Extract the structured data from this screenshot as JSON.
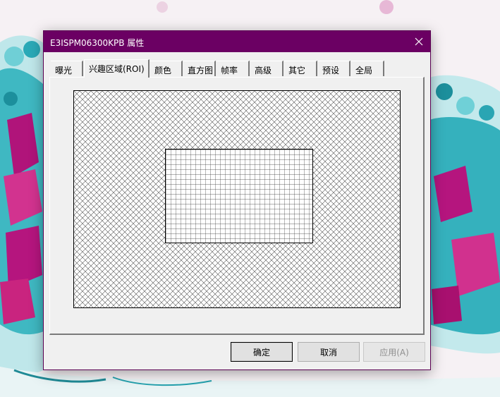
{
  "window": {
    "title": "E3ISPM06300KPB 属性",
    "close_icon": "close-icon"
  },
  "tabs": [
    {
      "label": "曝光",
      "active": false
    },
    {
      "label": "兴趣区域(ROI)",
      "active": true
    },
    {
      "label": "颜色",
      "active": false
    },
    {
      "label": "直方图",
      "active": false
    },
    {
      "label": "帧率",
      "active": false
    },
    {
      "label": "高级",
      "active": false
    },
    {
      "label": "其它",
      "active": false
    },
    {
      "label": "预设",
      "active": false
    },
    {
      "label": "全局",
      "active": false
    }
  ],
  "buttons": {
    "ok": "确定",
    "cancel": "取消",
    "apply": "应用(A)"
  },
  "colors": {
    "titlebar": "#6b0063",
    "dialog_bg": "#f0f0f0"
  }
}
